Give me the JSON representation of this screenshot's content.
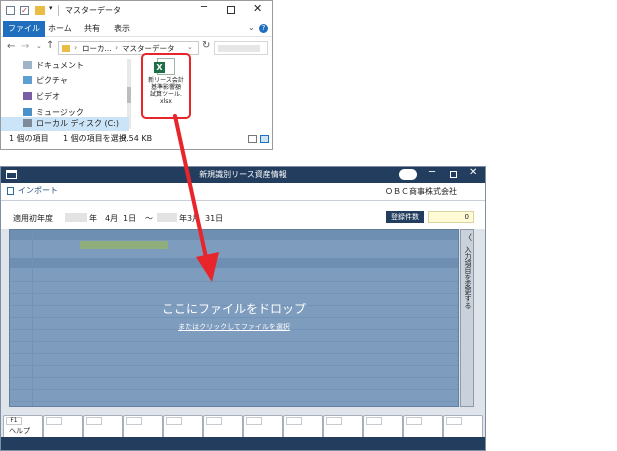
{
  "explorer": {
    "title": "マスターデータ",
    "ribbon_tabs": [
      "ファイル",
      "ホーム",
      "共有",
      "表示"
    ],
    "breadcrumb": [
      "ローカ...",
      "マスターデータ"
    ],
    "sidebar_items": [
      {
        "label": "ドキュメント",
        "icon": "document-icon"
      },
      {
        "label": "ピクチャ",
        "icon": "pictures-icon"
      },
      {
        "label": "ビデオ",
        "icon": "video-icon"
      },
      {
        "label": "ミュージック",
        "icon": "music-icon"
      },
      {
        "label": "ローカル ディスク (C:)",
        "icon": "drive-icon"
      }
    ],
    "file": {
      "name_lines": [
        "新リース会計",
        "基準影響額",
        "試算ツール.",
        "xlsx"
      ],
      "badge": "X"
    },
    "status": {
      "count": "1 個の項目",
      "selected": "1 個の項目を選択",
      "size": "9.54 KB"
    }
  },
  "app": {
    "title": "新規識別リース資産情報",
    "toolbar": {
      "import_label": "インポート",
      "company": "ＯＢＣ商事株式会社"
    },
    "filter": {
      "label": "適用初年度",
      "year_unit_1": "年",
      "month_1": "4月",
      "day_1": "1日",
      "tilde": "～",
      "year_unit_2": "年",
      "month_2": "3月",
      "day_2": "31日"
    },
    "count_label": "登録件数",
    "count_value": "0",
    "drop": {
      "title": "ここにファイルをドロップ",
      "link": "またはクリックしてファイルを選択"
    },
    "side_tab_label": "入力項目を変更する",
    "fkeys": [
      {
        "key": "F1",
        "label": "ヘルプ"
      }
    ]
  },
  "colors": {
    "title_bar": "#223d5e",
    "accent_red": "#e8252a",
    "excel_green": "#1d7044",
    "count_badge": "#223d5e"
  }
}
